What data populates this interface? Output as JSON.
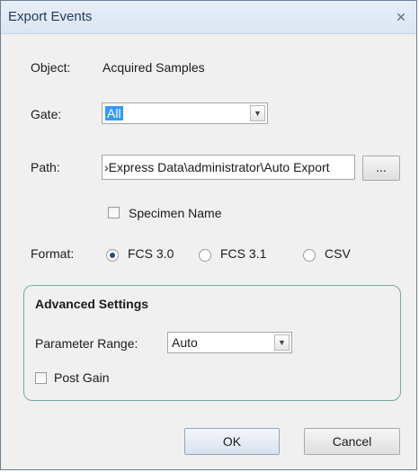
{
  "window": {
    "title": "Export Events",
    "close_glyph": "✕"
  },
  "object": {
    "label": "Object:",
    "value": "Acquired Samples"
  },
  "gate": {
    "label": "Gate:",
    "selected": "All"
  },
  "path": {
    "label": "Path:",
    "value": "›Express Data\\administrator\\Auto Export",
    "browse_label": "..."
  },
  "specimen_name": {
    "label": "Specimen Name",
    "checked": false
  },
  "format": {
    "label": "Format:",
    "options": [
      {
        "label": "FCS 3.0",
        "selected": true
      },
      {
        "label": "FCS 3.1",
        "selected": false
      },
      {
        "label": "CSV",
        "selected": false
      }
    ]
  },
  "advanced": {
    "title": "Advanced Settings",
    "parameter_range_label": "Parameter Range:",
    "parameter_range_value": "Auto",
    "post_gain_label": "Post Gain",
    "post_gain_checked": false
  },
  "buttons": {
    "ok": "OK",
    "cancel": "Cancel"
  }
}
